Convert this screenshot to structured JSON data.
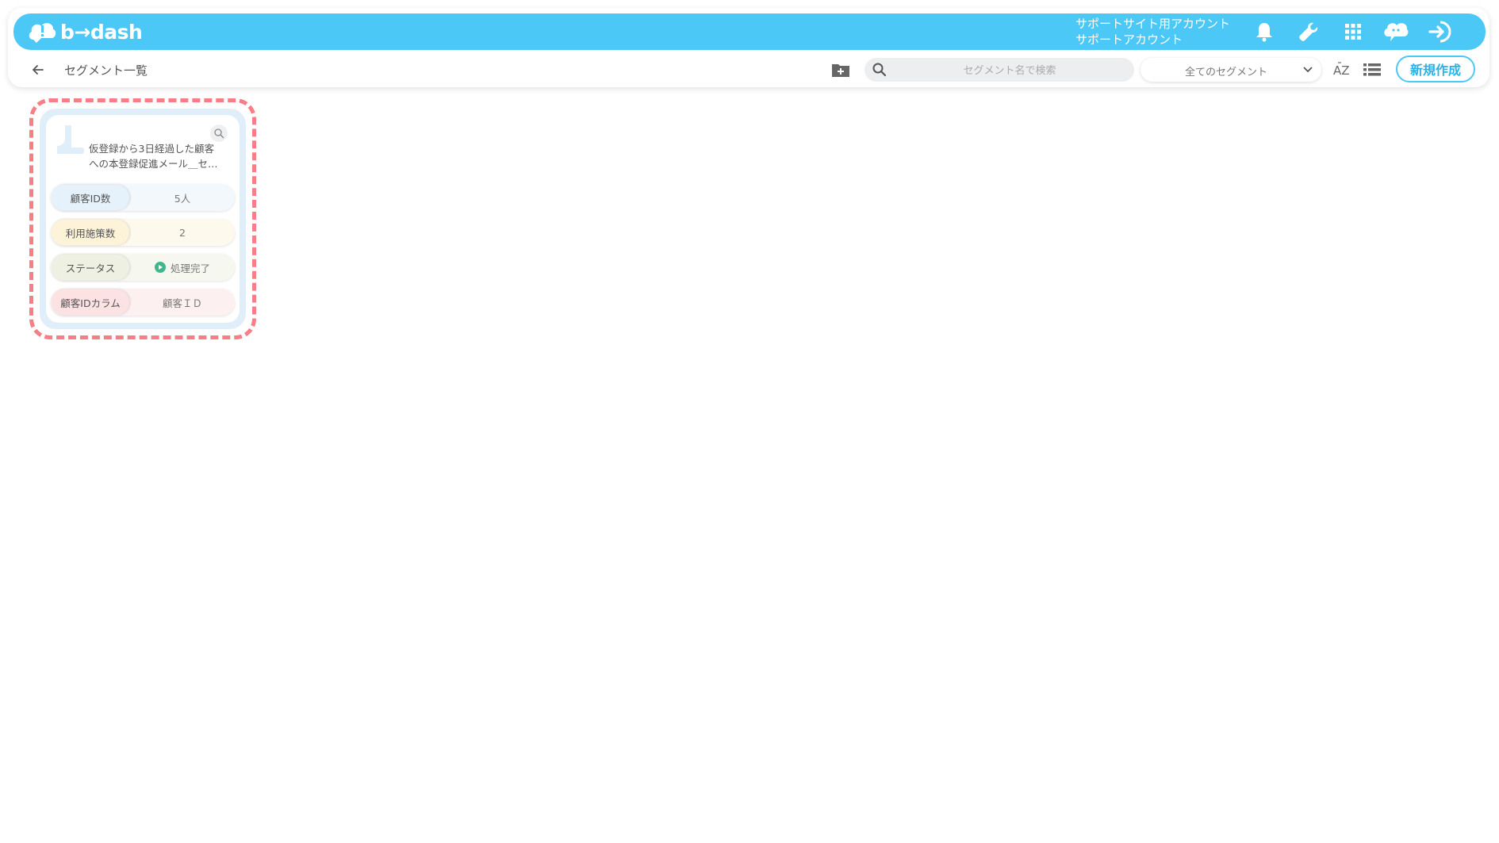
{
  "header": {
    "logo_text": "b→dash",
    "account_line1": "サポートサイト用アカウント",
    "account_line2": "サポートアカウント",
    "icons": [
      "bell-icon",
      "wrench-icon",
      "apps-grid-icon",
      "chat-bot-icon",
      "logout-icon"
    ]
  },
  "subbar": {
    "page_title": "セグメント一覧",
    "search_placeholder": "セグメント名で検索",
    "filter_selected": "全てのセグメント",
    "new_button": "新規作成"
  },
  "colors": {
    "brand": "#4cc8f6",
    "highlight_outline": "#f77e86",
    "row_customer_id": "#e6f2fb",
    "row_campaigns": "#fdf3d8",
    "row_status": "#eef1e2",
    "row_column": "#fde2e4"
  },
  "segments": [
    {
      "title": "仮登録から3日経過した顧客への本登録促進メール＿セ…",
      "rows": [
        {
          "label": "顧客ID数",
          "value": "5人"
        },
        {
          "label": "利用施策数",
          "value": "2"
        },
        {
          "label": "ステータス",
          "value": "処理完了"
        },
        {
          "label": "顧客IDカラム",
          "value": "顧客ＩＤ"
        }
      ]
    }
  ]
}
